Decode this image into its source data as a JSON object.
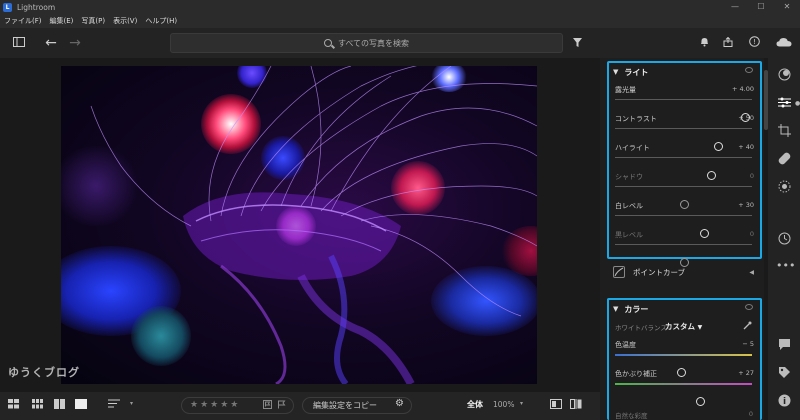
{
  "app": {
    "title": "Lightroom",
    "logo_letter": "L"
  },
  "window_controls": [
    "—",
    "☐",
    "✕"
  ],
  "menu": [
    "ファイル(F)",
    "編集(E)",
    "写真(P)",
    "表示(V)",
    "ヘルプ(H)"
  ],
  "toolbar": {
    "search_placeholder": "すべての写真を検索",
    "icons": [
      "panel-toggle-icon",
      "back-arrow-icon",
      "forward-arrow-icon",
      "filter-icon",
      "bell-icon",
      "share-icon",
      "info-icon",
      "cloud-icon"
    ]
  },
  "watermark": "ゆうくブログ",
  "bottom": {
    "zoom_label": "全体",
    "zoom_value": "100%",
    "copy_label": "編集設定をコピー",
    "stars": "★★★★★"
  },
  "light": {
    "title": "ライト",
    "sliders": [
      {
        "label": "露光量",
        "value": "+ 4.00",
        "pos": 0.95,
        "dim": false
      },
      {
        "label": "コントラスト",
        "value": "+ 50",
        "pos": 0.75,
        "dim": false
      },
      {
        "label": "ハイライト",
        "value": "+ 40",
        "pos": 0.7,
        "dim": false
      },
      {
        "label": "シャドウ",
        "value": "0",
        "pos": 0.5,
        "dim": true
      },
      {
        "label": "白レベル",
        "value": "+ 30",
        "pos": 0.65,
        "dim": false
      },
      {
        "label": "黒レベル",
        "value": "0",
        "pos": 0.5,
        "dim": true
      }
    ]
  },
  "point_curve": {
    "label": "ポイントカーブ"
  },
  "color": {
    "title": "カラー",
    "wb_label": "ホワイトバランス",
    "wb_value": "カスタム",
    "temp": {
      "label": "色温度",
      "value": "− 5",
      "pos": 0.48
    },
    "tint": {
      "label": "色かぶり補正",
      "value": "+ 27",
      "pos": 0.62
    }
  },
  "below": {
    "label": "自然な彩度",
    "value": "0"
  },
  "colors": {
    "accent": "#1aa9e6",
    "panel_bg": "#1e1e1e"
  }
}
